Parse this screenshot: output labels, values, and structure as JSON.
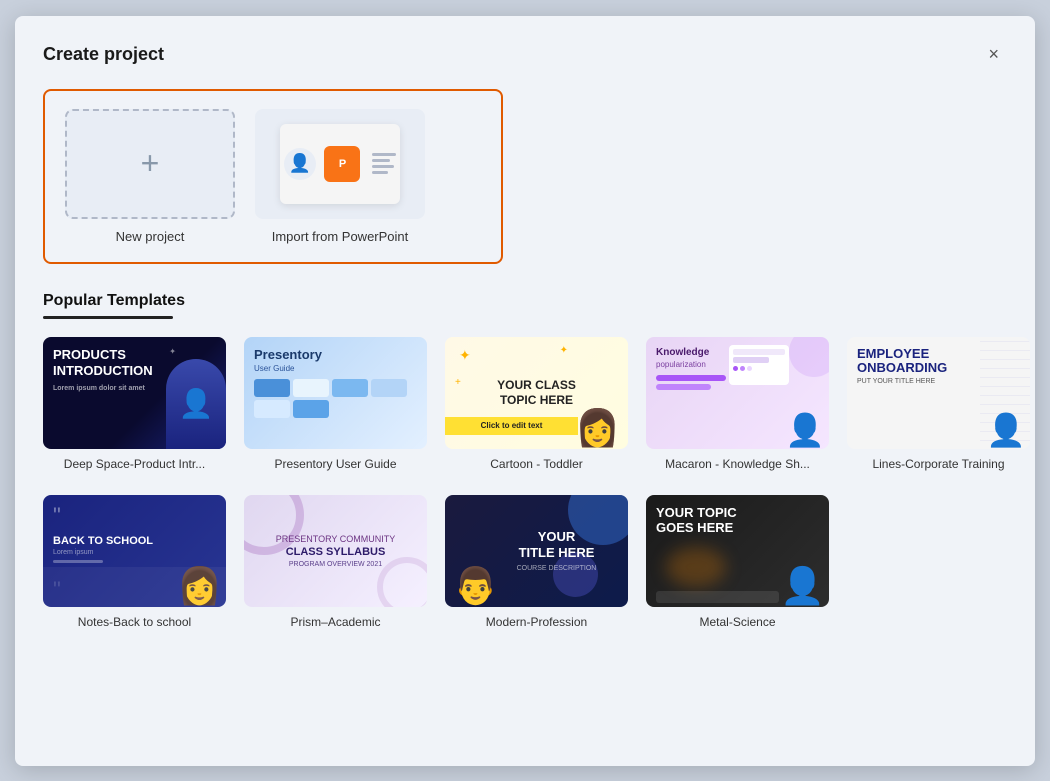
{
  "dialog": {
    "title": "Create project",
    "close_label": "×"
  },
  "top_section": {
    "new_project": {
      "label": "New project",
      "icon": "+"
    },
    "import_ppt": {
      "label": "Import from PowerPoint"
    }
  },
  "popular_templates": {
    "section_title": "Popular Templates",
    "row1": [
      {
        "id": "deep-space",
        "label": "Deep Space-Product Intr..."
      },
      {
        "id": "presentory",
        "label": "Presentory User Guide"
      },
      {
        "id": "cartoon",
        "label": "Cartoon - Toddler"
      },
      {
        "id": "macaron",
        "label": "Macaron - Knowledge Sh..."
      },
      {
        "id": "lines",
        "label": "Lines-Corporate Training"
      }
    ],
    "row2": [
      {
        "id": "notes",
        "label": "Notes-Back to school"
      },
      {
        "id": "prism",
        "label": "Prism–Academic"
      },
      {
        "id": "modern",
        "label": "Modern-Profession"
      },
      {
        "id": "metal",
        "label": "Metal-Science"
      }
    ]
  }
}
